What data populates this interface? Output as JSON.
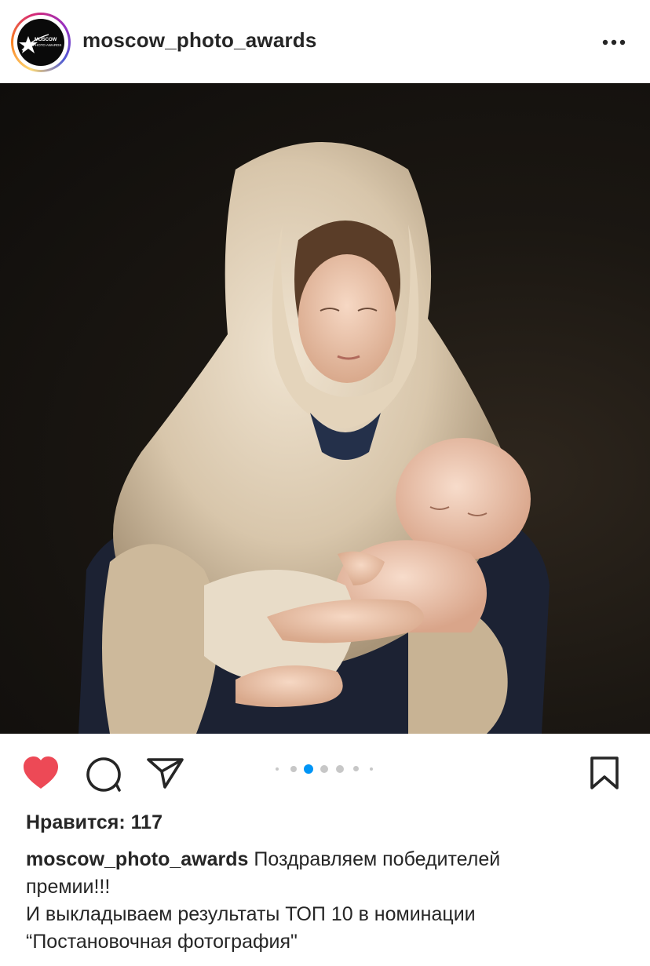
{
  "header": {
    "username": "moscow_photo_awards",
    "avatar_logo_text": "MOSCOW PHOTO AWARDS",
    "more_icon": "more-horizontal-icon"
  },
  "post": {
    "image_description_icon": "photo",
    "carousel": {
      "count": 6,
      "active_index": 2
    }
  },
  "actions": {
    "like_icon": "heart-filled-icon",
    "comment_icon": "comment-icon",
    "share_icon": "send-icon",
    "save_icon": "bookmark-icon",
    "like_color": "#ed4956"
  },
  "likes": {
    "text": "Нравится: 117"
  },
  "caption": {
    "username": "moscow_photo_awards",
    "line1": " Поздравляем победителей",
    "line2": "премии!!!",
    "line3": "И выкладываем результаты ТОП 10 в номинации",
    "line4": "“Постановочная фотография\""
  },
  "colors": {
    "accent_blue": "#0095f6",
    "text": "#262626",
    "dot_inactive": "#c7c7c7"
  }
}
